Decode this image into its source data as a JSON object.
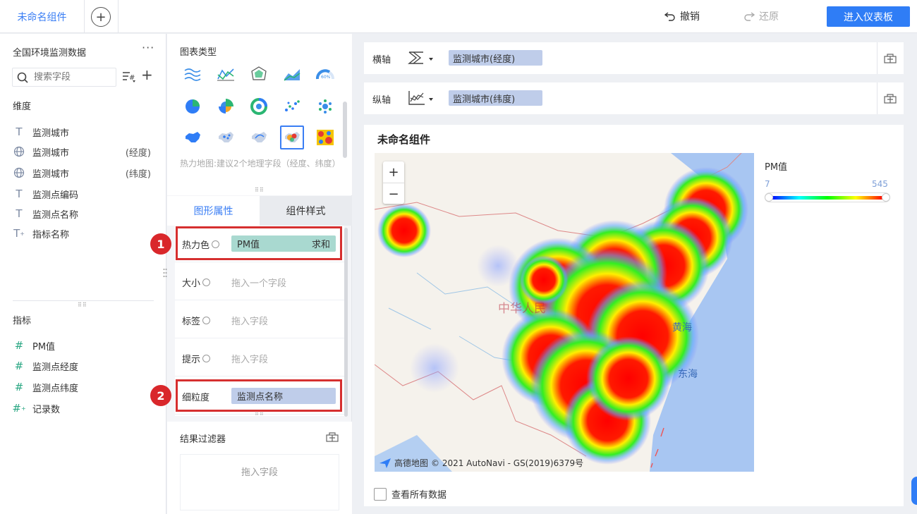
{
  "topbar": {
    "active_tab": "未命名组件",
    "add_tab": "+",
    "undo": "撤销",
    "redo": "还原",
    "enter_dashboard": "进入仪表板"
  },
  "left": {
    "dataset_name": "全国环境监测数据",
    "more": "···",
    "search_placeholder": "搜索字段",
    "add": "+",
    "dimensions_title": "维度",
    "dimensions": [
      {
        "icon": "text-field-icon",
        "label": "监测城市",
        "suffix": ""
      },
      {
        "icon": "globe-icon",
        "label": "监测城市",
        "suffix": "(经度)"
      },
      {
        "icon": "globe-icon",
        "label": "监测城市",
        "suffix": "(纬度)"
      },
      {
        "icon": "text-field-icon",
        "label": "监测点编码",
        "suffix": ""
      },
      {
        "icon": "text-field-icon",
        "label": "监测点名称",
        "suffix": ""
      },
      {
        "icon": "calc-text-field-icon",
        "label": "指标名称",
        "suffix": ""
      }
    ],
    "measures_title": "指标",
    "measures": [
      {
        "icon": "hash-icon",
        "label": "PM值"
      },
      {
        "icon": "hash-icon",
        "label": "监测点经度"
      },
      {
        "icon": "hash-icon",
        "label": "监测点纬度"
      },
      {
        "icon": "calc-hash-icon",
        "label": "记录数"
      }
    ]
  },
  "middle": {
    "chart_types_title": "图表类型",
    "chart_types_hint": "热力地图:建议2个地理字段（经度、纬度）",
    "tabs": [
      "图形属性",
      "组件样式"
    ],
    "props": {
      "heat_color_label": "热力色",
      "heat_color_field": "PM值",
      "heat_color_agg": "求和",
      "size_label": "大小",
      "size_placeholder": "拖入一个字段",
      "label_label": "标签",
      "label_placeholder": "拖入字段",
      "tooltip_label": "提示",
      "tooltip_placeholder": "拖入字段",
      "granularity_label": "细粒度",
      "granularity_field": "监测点名称"
    },
    "badges": [
      "1",
      "2"
    ],
    "result_filter_title": "结果过滤器",
    "result_filter_placeholder": "拖入字段"
  },
  "right": {
    "x_axis_label": "横轴",
    "x_axis_field": "监测城市(经度)",
    "y_axis_label": "纵轴",
    "y_axis_field": "监测城市(纬度)",
    "widget_title": "未命名组件",
    "zoom_in": "+",
    "zoom_out": "−",
    "map_labels": {
      "country": "中华人民",
      "sea1": "黄海",
      "sea2": "东海"
    },
    "attribution_logo": "高德地图",
    "attribution": "© 2021 AutoNavi - GS(2019)6379号",
    "legend_title": "PM值",
    "legend_min": "7",
    "legend_max": "545",
    "view_all": "查看所有数据"
  },
  "colors": {
    "accent": "#2f7df6",
    "heat_color_pill": "#a9d9d0",
    "field_pill": "#bfcdea",
    "highlight_red": "#d62f2f"
  }
}
